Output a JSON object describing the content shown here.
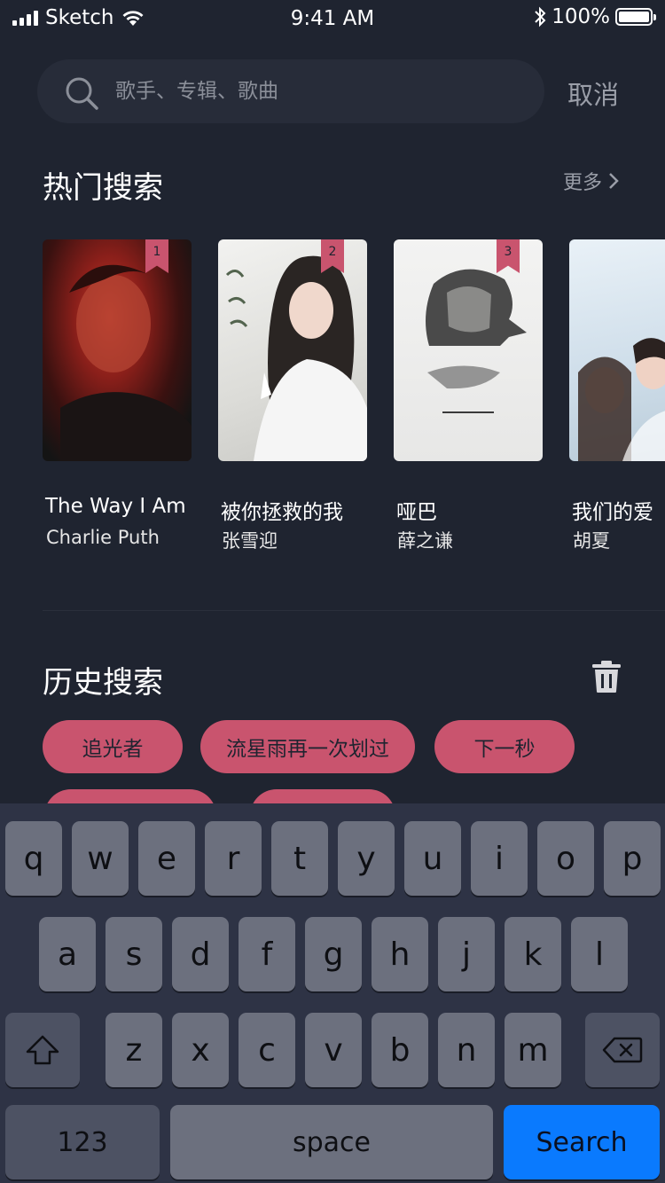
{
  "status_bar": {
    "carrier": "Sketch",
    "time": "9:41 AM",
    "battery": "100%"
  },
  "search": {
    "placeholder": "歌手、专辑、歌曲",
    "cancel_label": "取消"
  },
  "hot_section": {
    "title": "热门搜索",
    "more_label": "更多",
    "items": [
      {
        "rank": "1",
        "title": "The Way I Am",
        "artist": "Charlie Puth"
      },
      {
        "rank": "2",
        "title": "被你拯救的我",
        "artist": "张雪迎"
      },
      {
        "rank": "3",
        "title": "哑巴",
        "artist": "薛之谦"
      },
      {
        "rank": "",
        "title": "我们的爱",
        "artist": "胡夏"
      }
    ]
  },
  "history_section": {
    "title": "历史搜索",
    "tags": [
      "追光者",
      "流星雨再一次划过",
      "下一秒"
    ]
  },
  "keyboard": {
    "row1": [
      "q",
      "w",
      "e",
      "r",
      "t",
      "y",
      "u",
      "i",
      "o",
      "p"
    ],
    "row2": [
      "a",
      "s",
      "d",
      "f",
      "g",
      "h",
      "j",
      "k",
      "l"
    ],
    "row3": [
      "z",
      "x",
      "c",
      "v",
      "b",
      "n",
      "m"
    ],
    "numbers_label": "123",
    "space_label": "space",
    "search_label": "Search"
  },
  "colors": {
    "background": "#1f2430",
    "accent": "#c9546e",
    "search_key": "#0a7afe"
  }
}
